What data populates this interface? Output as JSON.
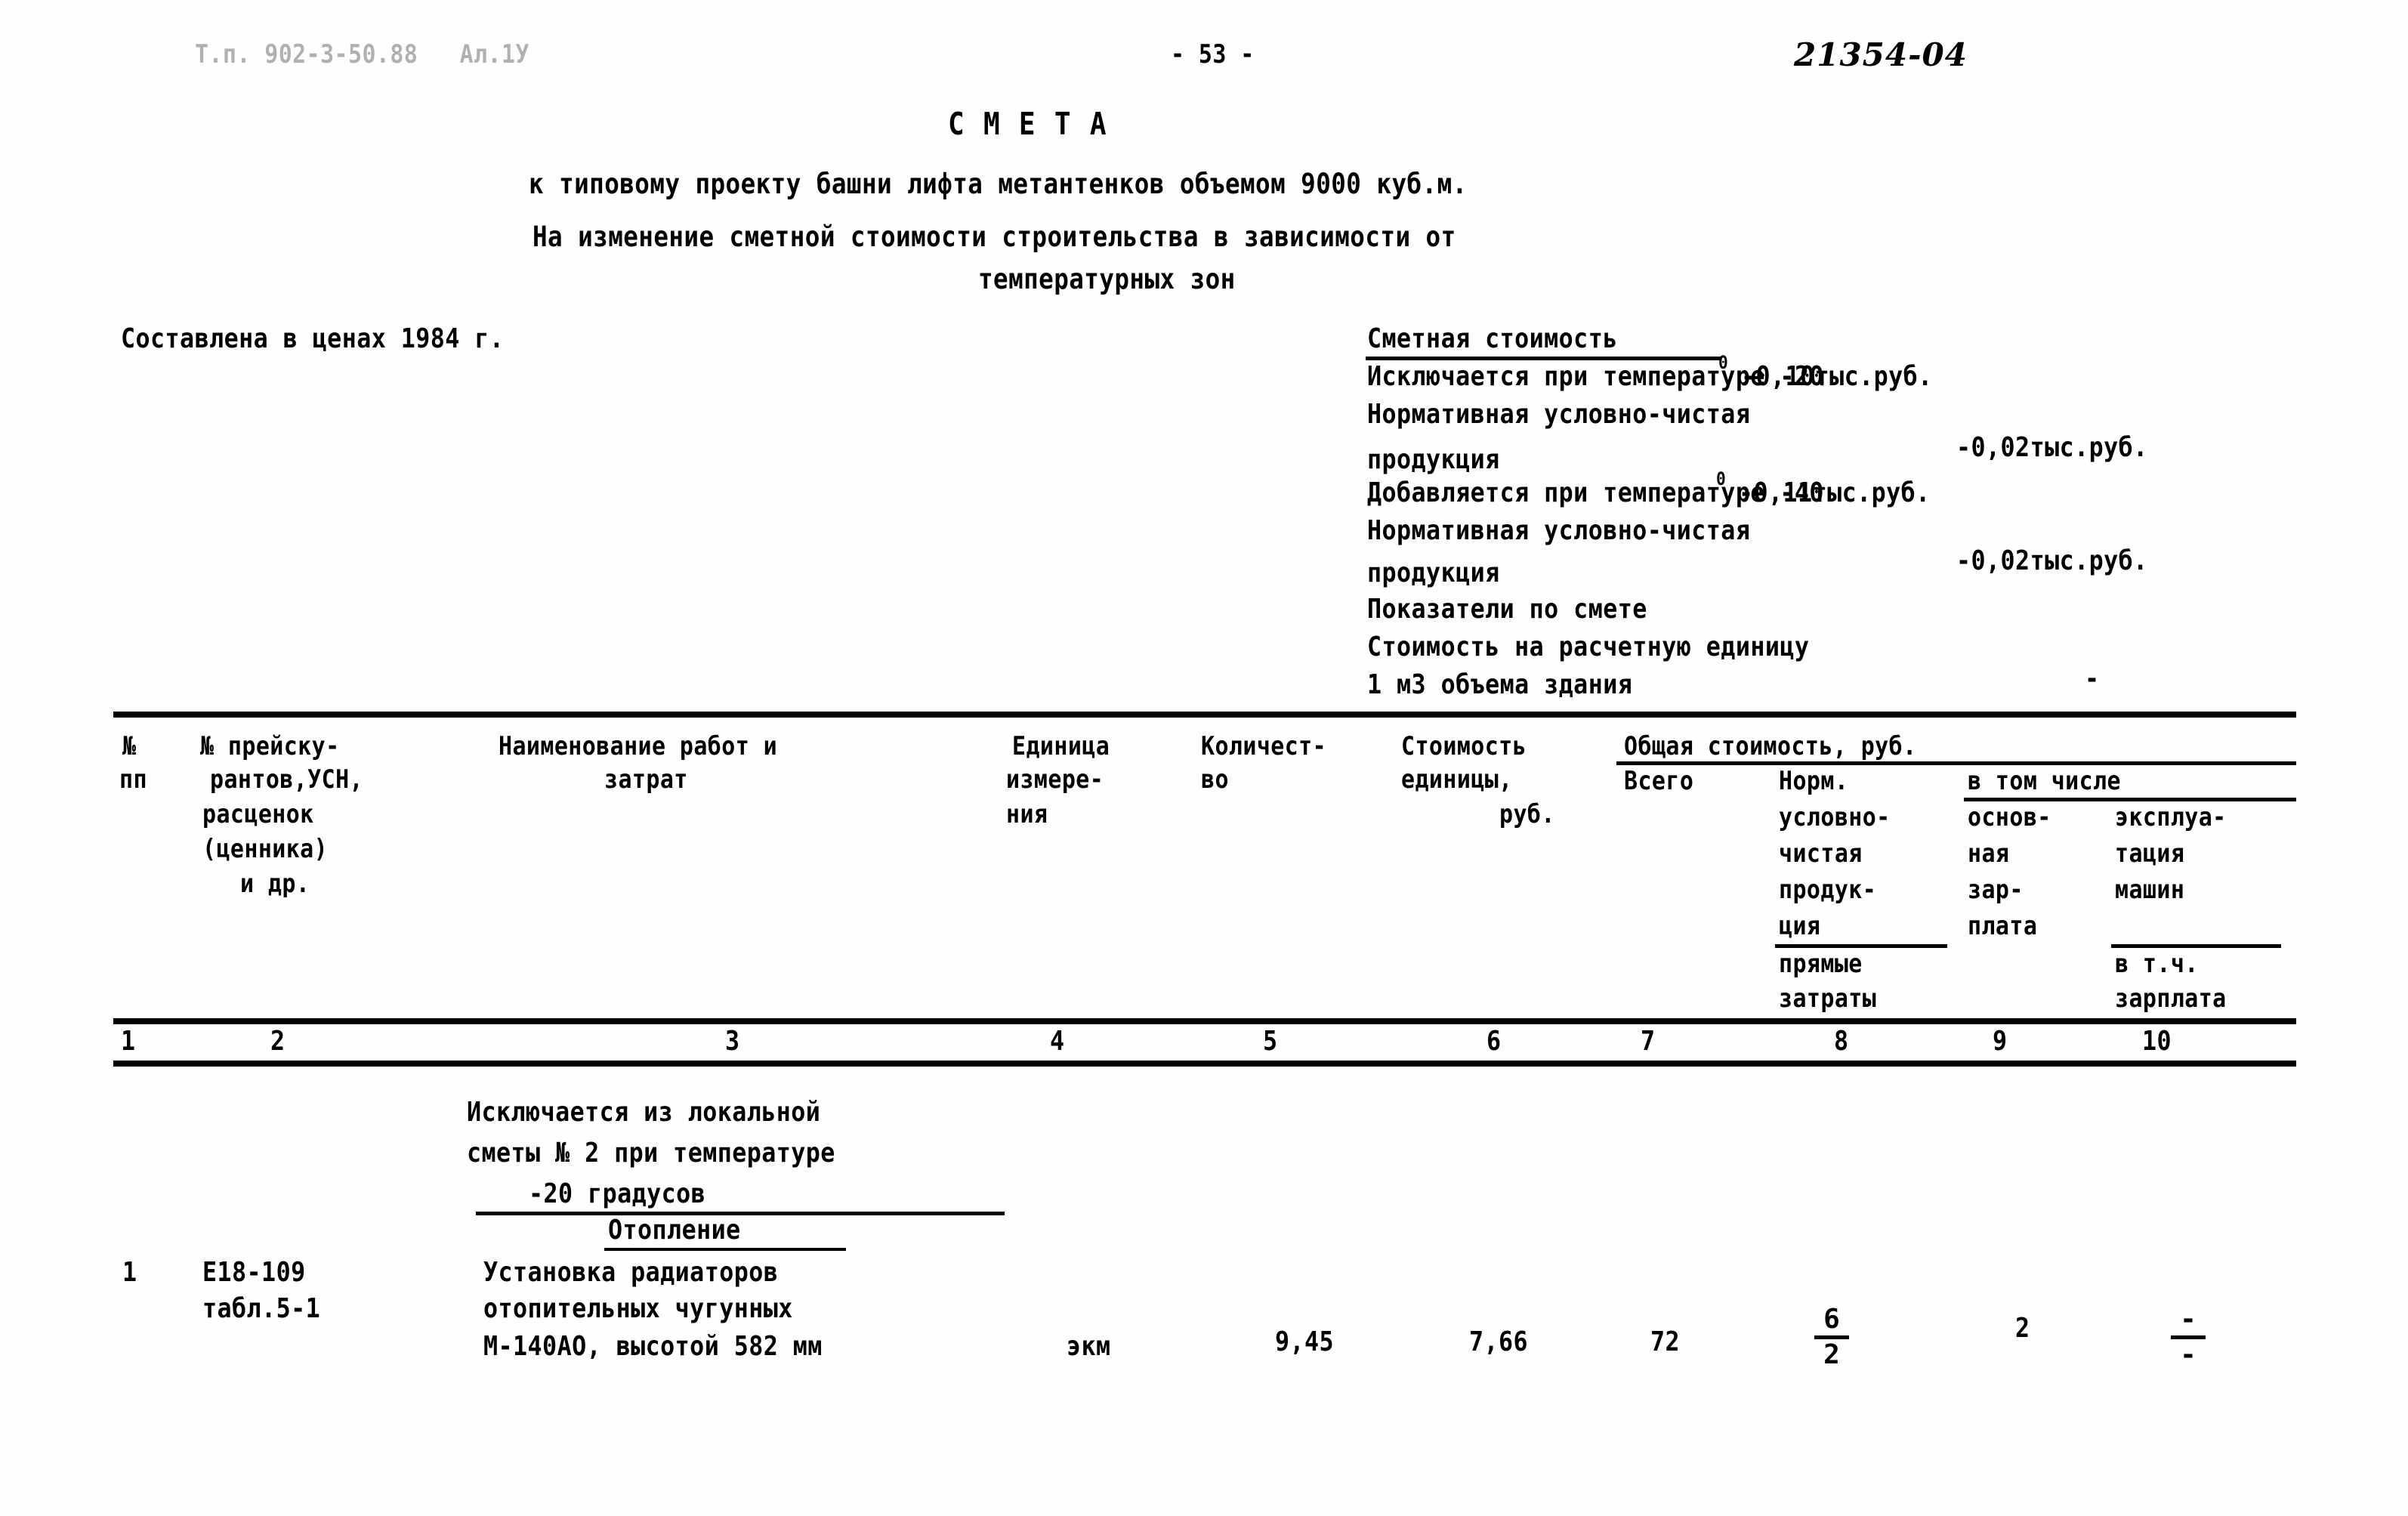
{
  "header": {
    "left_code": "Т.п. 902-3-50.88   Ал.1У",
    "page_number": "- 53 -",
    "doc_number": "21354-04"
  },
  "title": {
    "main": "С М Е Т А",
    "line1": "к типовому проекту башни лифта метантенков объемом 9000 куб.м.",
    "line2": "На изменение сметной стоимости строительства в зависимости от",
    "line3": "температурных зон"
  },
  "prices_note": "Составлена в ценах 1984 г.",
  "summary": {
    "heading": "Сметная стоимость",
    "rows": [
      {
        "label": "Исключается при температуре -20",
        "sup": "0",
        "value": "-0,10тыс.руб."
      },
      {
        "label": "Нормативная условно-чистая",
        "sup": "",
        "value": ""
      },
      {
        "label": "продукция",
        "sup": "",
        "value": "-0,02тыс.руб."
      },
      {
        "label": "Добавляется при температуре -40",
        "sup": "0",
        "value": "-0,11тыс.руб."
      },
      {
        "label": "Нормативная условно-чистая",
        "sup": "",
        "value": ""
      },
      {
        "label": "продукция",
        "sup": "",
        "value": "-0,02тыс.руб."
      },
      {
        "label": "Показатели по смете",
        "sup": "",
        "value": ""
      },
      {
        "label": "Стоимость на расчетную единицу",
        "sup": "",
        "value": ""
      },
      {
        "label": "1 м3 объема здания",
        "sup": "",
        "value": "-"
      }
    ]
  },
  "table": {
    "headers": {
      "c1": [
        "№",
        "пп"
      ],
      "c2": [
        "№ прейску-",
        "рантов,УСН,",
        "расценок",
        "(ценника)",
        "и др."
      ],
      "c3": [
        "Наименование работ и",
        "затрат"
      ],
      "c4": [
        "Единица",
        "измере-",
        "ния"
      ],
      "c5": [
        "Количест-",
        "во"
      ],
      "c6": [
        "Стоимость",
        "единицы,",
        "руб."
      ],
      "group_total": "Общая стоимость, руб.",
      "c7": [
        "Всего"
      ],
      "c8": [
        "Норм.",
        "условно-",
        "чистая",
        "продук-",
        "ция"
      ],
      "c8b": [
        "прямые",
        "затраты"
      ],
      "group_including": "в том числе",
      "c9": [
        "основ-",
        "ная",
        "зар-",
        "плата"
      ],
      "c10": [
        "эксплуа-",
        "тация",
        "машин"
      ],
      "c10b": [
        "в т.ч.",
        "зарплата"
      ]
    },
    "column_numbers": [
      "1",
      "2",
      "3",
      "4",
      "5",
      "6",
      "7",
      "8",
      "9",
      "10"
    ],
    "section_note": [
      "Исключается из локальной",
      "сметы № 2 при температуре",
      "-20 градусов"
    ],
    "section_title": "Отопление",
    "rows": [
      {
        "no": "1",
        "code": [
          "Е18-109",
          "табл.5-1"
        ],
        "name": [
          "Установка радиаторов",
          "отопительных чугунных",
          "М-140АО, высотой 582 мм"
        ],
        "unit": "экм",
        "qty": "9,45",
        "unit_cost": "7,66",
        "total": "72",
        "norm_num": "6",
        "norm_den": "2",
        "base_salary": "2",
        "machines_num": "-",
        "machines_den": "-"
      }
    ]
  }
}
